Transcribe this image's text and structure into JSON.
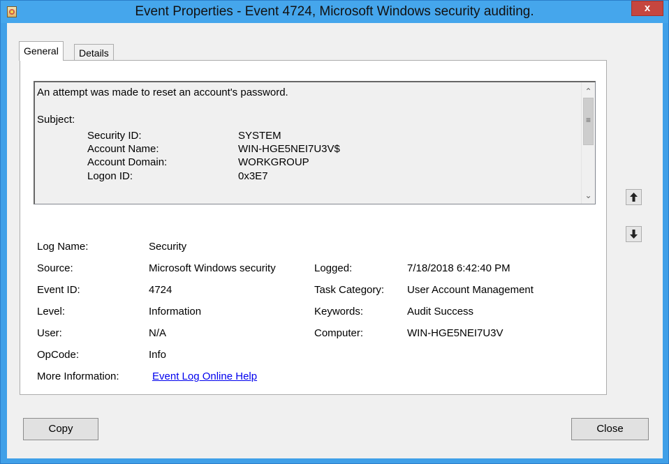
{
  "window": {
    "title": "Event Properties - Event 4724, Microsoft Windows security auditing.",
    "close_glyph": "x"
  },
  "tabs": [
    {
      "label": "General"
    },
    {
      "label": "Details"
    }
  ],
  "description": {
    "line1": "An attempt was made to reset an account's password.",
    "subject_heading": "Subject:",
    "fields": [
      {
        "label": "Security ID:",
        "value": "SYSTEM"
      },
      {
        "label": "Account Name:",
        "value": "WIN-HGE5NEI7U3V$"
      },
      {
        "label": "Account Domain:",
        "value": "WORKGROUP"
      },
      {
        "label": "Logon ID:",
        "value": "0x3E7"
      }
    ]
  },
  "properties": {
    "log_name": {
      "label": "Log Name:",
      "value": "Security"
    },
    "source": {
      "label": "Source:",
      "value": "Microsoft Windows security"
    },
    "event_id": {
      "label": "Event ID:",
      "value": "4724"
    },
    "level": {
      "label": "Level:",
      "value": "Information"
    },
    "user": {
      "label": "User:",
      "value": "N/A"
    },
    "opcode": {
      "label": "OpCode:",
      "value": "Info"
    },
    "more_info": {
      "label": "More Information:",
      "value": "Event Log Online Help"
    },
    "logged": {
      "label": "Logged:",
      "value": "7/18/2018 6:42:40 PM"
    },
    "task_category": {
      "label": "Task Category:",
      "value": "User Account Management"
    },
    "keywords": {
      "label": "Keywords:",
      "value": "Audit Success"
    },
    "computer": {
      "label": "Computer:",
      "value": "WIN-HGE5NEI7U3V"
    }
  },
  "buttons": {
    "copy": "Copy",
    "close": "Close"
  },
  "colors": {
    "title_bar": "#45a6ec",
    "close_button": "#c6463f",
    "link": "#0000ee"
  }
}
